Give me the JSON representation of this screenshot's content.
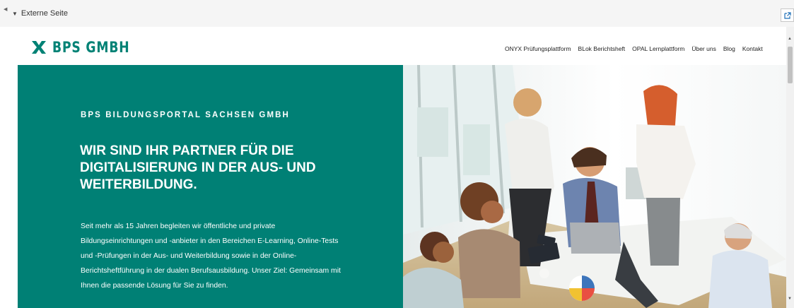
{
  "external_bar": {
    "label": "Externe Seite"
  },
  "brand": {
    "name": "BPS GMBH",
    "color": "#008275"
  },
  "nav": {
    "items": [
      "ONYX Prüfungsplattform",
      "BLok Berichtsheft",
      "OPAL Lernplattform",
      "Über uns",
      "Blog",
      "Kontakt"
    ]
  },
  "hero": {
    "eyebrow": "BPS BILDUNGSPORTAL SACHSEN GMBH",
    "headline": "WIR SIND IHR PARTNER FÜR DIE DIGITALISIERUNG IN DER AUS- UND WEITERBILDUNG.",
    "body": "Seit mehr als 15 Jahren begleiten wir öffentliche und private Bildungseinrichtungen und -anbieter in den Bereichen E-Learning, Online-Tests und -Prüfungen in der Aus- und Weiterbildung sowie in der Online-Berichtsheftführung in der dualen Berufsausbildung. Unser Ziel: Gemeinsam mit Ihnen die passende Lösung für Sie zu finden.",
    "background": "#008075"
  }
}
